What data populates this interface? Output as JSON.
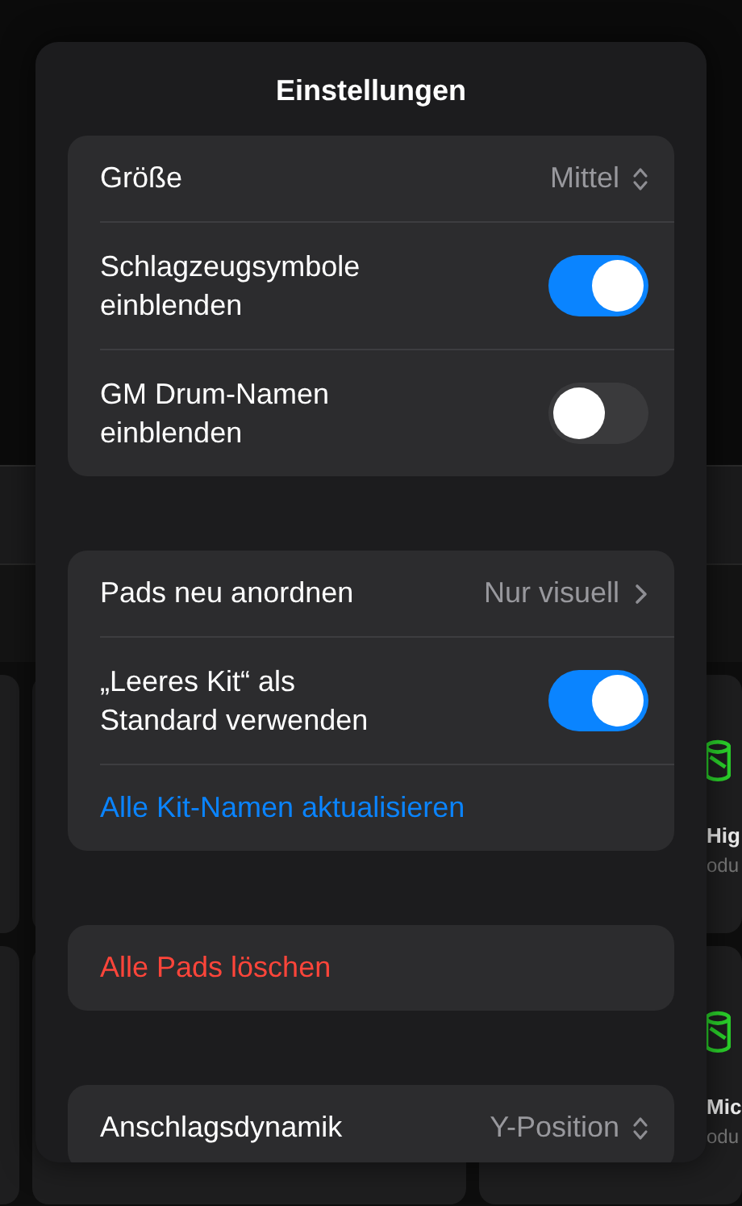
{
  "background_pads": [
    {
      "title": "Hig",
      "subtitle": "odu"
    },
    {
      "title": "Mic",
      "subtitle": "odu"
    }
  ],
  "popover": {
    "title": "Einstellungen",
    "groups": [
      {
        "rows": [
          {
            "kind": "picker",
            "label": "Größe",
            "value": "Mittel"
          },
          {
            "kind": "toggle",
            "label": "Schlagzeugsymbole\neinblenden",
            "on": true
          },
          {
            "kind": "toggle",
            "label": "GM Drum-Namen\neinblenden",
            "on": false
          }
        ]
      },
      {
        "rows": [
          {
            "kind": "link",
            "label": "Pads neu anordnen",
            "value": "Nur visuell"
          },
          {
            "kind": "toggle",
            "label": "„Leeres Kit“ als\nStandard verwenden",
            "on": true
          },
          {
            "kind": "action",
            "label": "Alle Kit-Namen aktualisieren"
          }
        ]
      },
      {
        "rows": [
          {
            "kind": "destructive",
            "label": "Alle Pads löschen"
          }
        ]
      },
      {
        "rows": [
          {
            "kind": "picker",
            "label": "Anschlagsdynamik",
            "value": "Y-Position"
          }
        ]
      }
    ]
  }
}
